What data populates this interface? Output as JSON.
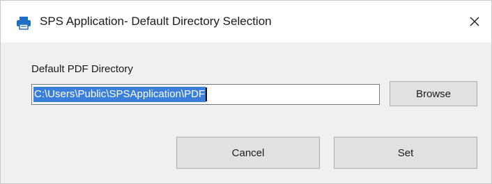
{
  "window": {
    "title": "SPS Application- Default Directory Selection",
    "icon": "printer-icon",
    "close_icon": "close-icon"
  },
  "form": {
    "directory_label": "Default PDF Directory",
    "directory_value": "C:\\Users\\Public\\SPSApplication\\PDF",
    "browse_label": "Browse",
    "cancel_label": "Cancel",
    "set_label": "Set"
  },
  "colors": {
    "selection": "#3a7fd9",
    "button_face": "#e1e1e1",
    "dialog_bg": "#f0f0f0"
  }
}
